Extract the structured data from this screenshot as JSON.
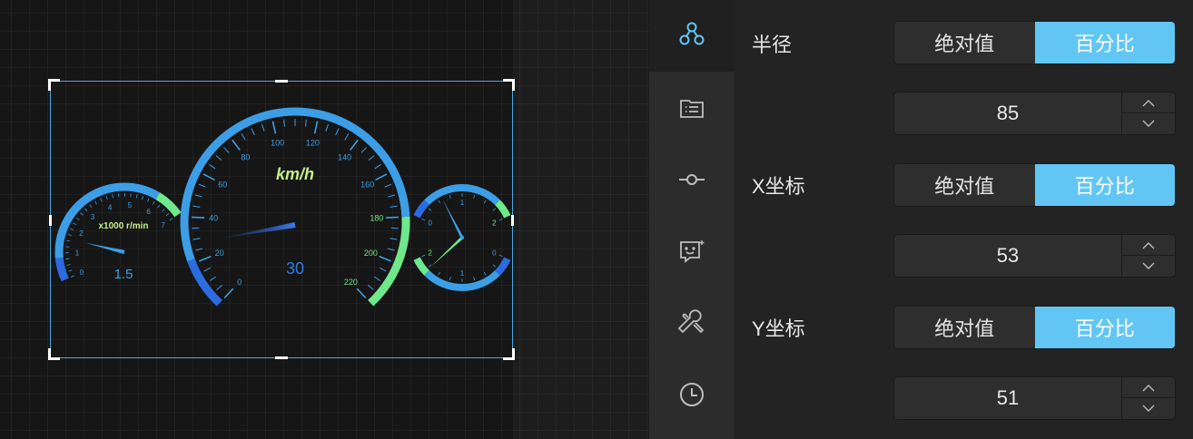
{
  "dashboard": {
    "speed_unit": "km/h",
    "speed_value": "30",
    "speed_ticks": [
      "0",
      "20",
      "40",
      "60",
      "80",
      "100",
      "120",
      "140",
      "160",
      "180",
      "200",
      "220"
    ],
    "rpm_unit": "x1000 r/min",
    "rpm_value": "1.5",
    "rpm_ticks": [
      "0",
      "1",
      "2",
      "3",
      "4",
      "5",
      "6",
      "7"
    ],
    "fuel_ticks": [
      "0",
      "1",
      "2"
    ],
    "temp_ticks": [
      "2",
      "1",
      "0"
    ],
    "colors": {
      "blue": "#3c9ee6",
      "green": "#6ee88a",
      "deep_blue": "#2d6be0",
      "label": "#c6f08a"
    }
  },
  "sidebar_tabs": [
    {
      "icon": "share-icon",
      "active": true
    },
    {
      "icon": "list-card-icon",
      "active": false
    },
    {
      "icon": "commit-node-icon",
      "active": false
    },
    {
      "icon": "chat-smile-icon",
      "active": false
    },
    {
      "icon": "tools-icon",
      "active": false
    },
    {
      "icon": "clock-icon",
      "active": false
    }
  ],
  "properties": {
    "radius": {
      "label": "半径",
      "options": [
        "绝对值",
        "百分比"
      ],
      "selected": "百分比",
      "value": "85"
    },
    "x": {
      "label": "X坐标",
      "options": [
        "绝对值",
        "百分比"
      ],
      "selected": "百分比",
      "value": "53"
    },
    "y": {
      "label": "Y坐标",
      "options": [
        "绝对值",
        "百分比"
      ],
      "selected": "百分比",
      "value": "51"
    }
  }
}
